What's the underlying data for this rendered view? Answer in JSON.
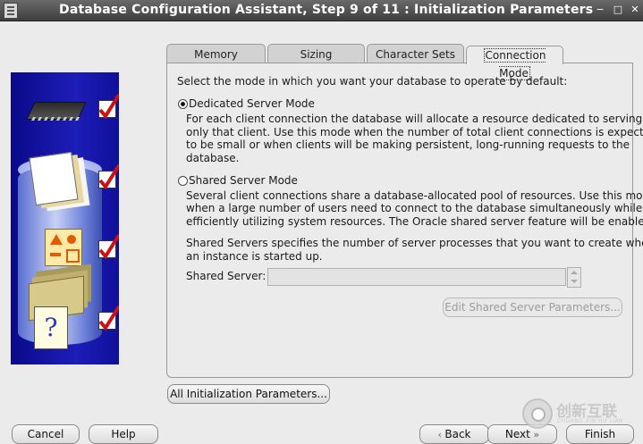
{
  "window": {
    "title": "Database Configuration Assistant, Step 9 of 11 : Initialization Parameters",
    "controls": [
      "−",
      "□",
      "✕"
    ]
  },
  "tabs": [
    {
      "label": "Memory",
      "active": false
    },
    {
      "label": "Sizing",
      "active": false
    },
    {
      "label": "Character Sets",
      "active": false
    },
    {
      "label": "Connection Mode",
      "active": true
    }
  ],
  "connection_mode": {
    "intro": "Select the mode in which you want your database to operate by default:",
    "dedicated": {
      "label": "Dedicated Server Mode",
      "selected": true,
      "description": [
        "For each client connection the database will allocate a resource dedicated to serving",
        "only that client.  Use this mode when the number of total client connections is expected",
        "to be small or when clients will be making persistent, long-running requests to the",
        "database."
      ]
    },
    "shared": {
      "label": "Shared Server Mode",
      "selected": false,
      "description": [
        "Several client connections share a database-allocated pool of resources.  Use this mode",
        "when a large number of users need to connect to the database simultaneously while",
        "efficiently utilizing system resources.  The Oracle shared server feature will be enabled."
      ],
      "servers_info": [
        "Shared Servers specifies the number of server processes that you want to create when",
        "an instance is started up."
      ],
      "field_label": "Shared Server:",
      "field_value": "",
      "edit_button": "Edit Shared Server Parameters..."
    }
  },
  "all_params_button": "All Initialization Parameters...",
  "footer": {
    "cancel": "Cancel",
    "help": "Help",
    "back": "Back",
    "next": "Next",
    "finish": "Finish"
  },
  "watermark": {
    "name": "创新互联",
    "sub": "CHUANG XIN HU LIAN"
  }
}
